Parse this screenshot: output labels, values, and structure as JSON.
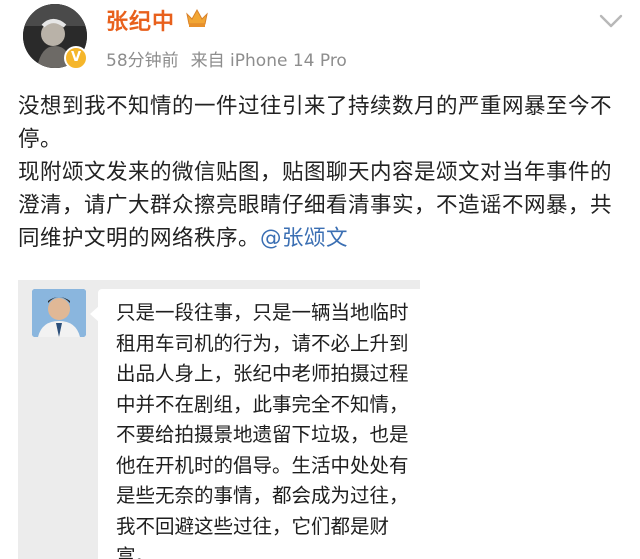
{
  "post": {
    "author": "张纪中",
    "time": "58分钟前",
    "source": "来自 iPhone 14 Pro",
    "paragraphs": [
      "没想到我不知情的一件过往引来了持续数月的严重网暴至今不停。",
      "现附颂文发来的微信贴图，贴图聊天内容是颂文对当年事件的澄清，请广大群众擦亮眼睛仔细看清事实，不造谣不网暴，共同维护文明的网络秩序。"
    ],
    "mention": "@张颂文"
  },
  "embedded_chat": {
    "lines": [
      "只是一段往事，只是一辆当地临时",
      "租用车司机的行为，请不必上升到",
      "出品人身上，张纪中老师拍摄过程",
      "中并不在剧组，此事完全不知情，",
      "不要给拍摄景地遗留下垃圾，也是",
      "他在开机时的倡导。生活中处处有",
      "是些无奈的事情，都会成为过往，",
      "我不回避这些过往，它们都是财",
      "富。"
    ]
  },
  "icons": {
    "verified": "verified-badge-icon",
    "crown": "crown-icon",
    "more": "chevron-down-icon"
  },
  "colors": {
    "username": "#e8601c",
    "mention": "#3b6fb3",
    "meta": "#8d8d8d",
    "verified": "#f5b62b"
  }
}
